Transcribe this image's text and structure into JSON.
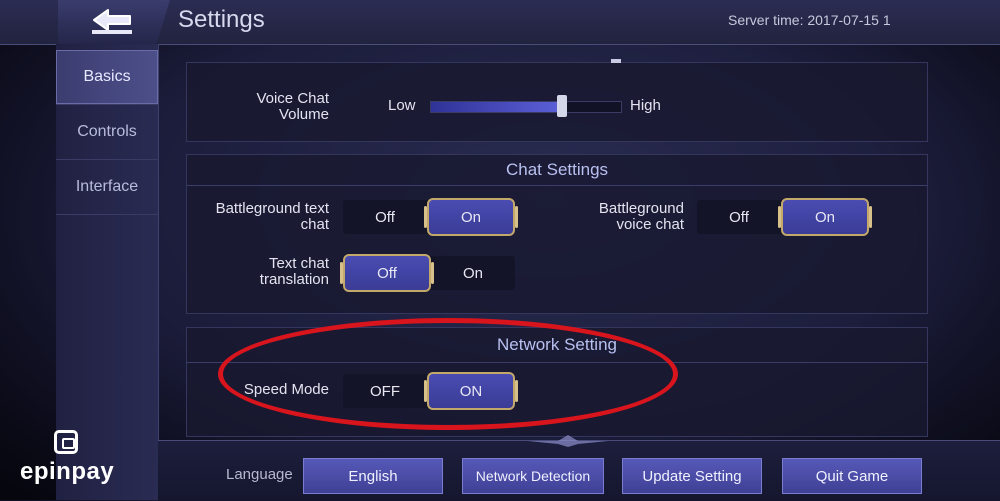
{
  "header": {
    "title": "Settings",
    "server_time": "Server time: 2017-07-15 1"
  },
  "sidebar": {
    "items": [
      {
        "label": "Basics"
      },
      {
        "label": "Controls"
      },
      {
        "label": "Interface"
      }
    ]
  },
  "voice_volume": {
    "label_line1": "Voice Chat",
    "label_line2": "Volume",
    "low": "Low",
    "high": "High",
    "level": 0.69
  },
  "chat_settings": {
    "heading": "Chat Settings",
    "battleground_text": {
      "label_line1": "Battleground text",
      "label_line2": "chat",
      "off": "Off",
      "on": "On",
      "selected": "On"
    },
    "battleground_voice": {
      "label_line1": "Battleground",
      "label_line2": "voice chat",
      "off": "Off",
      "on": "On",
      "selected": "On"
    },
    "text_translation": {
      "label_line1": "Text chat",
      "label_line2": "translation",
      "off": "Off",
      "on": "On",
      "selected": "Off"
    }
  },
  "network_setting": {
    "heading": "Network Setting",
    "speed_mode": {
      "label": "Speed Mode",
      "off": "OFF",
      "on": "ON",
      "selected": "ON"
    }
  },
  "bottom": {
    "language_label": "Language",
    "language_value": "English",
    "network_detection": "Network Detection",
    "update_setting": "Update Setting",
    "quit_game": "Quit Game"
  },
  "watermark": {
    "text": "epinpay"
  },
  "colors": {
    "accent_button": "#4a4cb2",
    "highlight_ellipse": "#d8141c",
    "selected_border": "#c2a86a"
  }
}
